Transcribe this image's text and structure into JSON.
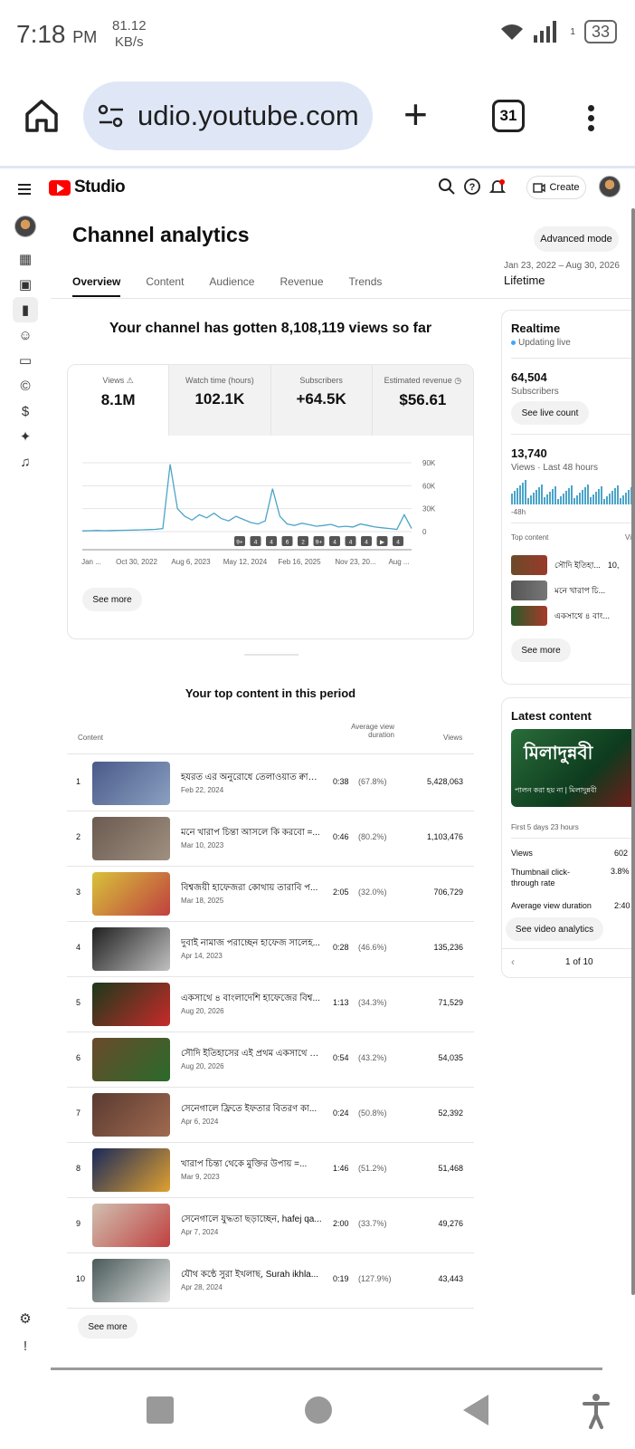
{
  "status": {
    "time": "7:18",
    "ampm": "PM",
    "speed_value": "81.12",
    "speed_unit": "KB/s",
    "battery": "33",
    "sim_slot": "1"
  },
  "browser": {
    "url": "udio.youtube.com",
    "tab_count": "31"
  },
  "studio": {
    "logo_text": "Studio",
    "create_label": "Create",
    "page_title": "Channel analytics",
    "advanced_mode": "Advanced mode",
    "date_range": "Jan 23, 2022 – Aug 30, 2026",
    "period": "Lifetime",
    "tabs": [
      {
        "label": "Overview"
      },
      {
        "label": "Content"
      },
      {
        "label": "Audience"
      },
      {
        "label": "Revenue"
      },
      {
        "label": "Trends"
      }
    ],
    "headline": "Your channel has gotten 8,108,119 views so far",
    "metrics": [
      {
        "label": "Views",
        "value": "8.1M"
      },
      {
        "label": "Watch time (hours)",
        "value": "102.1K"
      },
      {
        "label": "Subscribers",
        "value": "+64.5K"
      },
      {
        "label": "Estimated revenue",
        "value": "$56.61"
      }
    ],
    "see_more": "See more",
    "top_title": "Your top content in this period",
    "columns": {
      "content": "Content",
      "avg_line1": "Average view",
      "avg_line2": "duration",
      "views": "Views"
    },
    "rows": [
      {
        "rank": "1",
        "title": "হযরত এর অনুরোধে তেলাওয়াত ক্বারী...",
        "date": "Feb 22, 2024",
        "dur": "0:38",
        "pct": "(67.8%)",
        "views": "5,428,063"
      },
      {
        "rank": "2",
        "title": "মনে খারাপ চিন্তা আসলে কি করবো =...",
        "date": "Mar 10, 2023",
        "dur": "0:46",
        "pct": "(80.2%)",
        "views": "1,103,476"
      },
      {
        "rank": "3",
        "title": "বিশ্বজয়ী হাফেজরা কোথায় তারাবি প...",
        "date": "Mar 18, 2025",
        "dur": "2:05",
        "pct": "(32.0%)",
        "views": "706,729"
      },
      {
        "rank": "4",
        "title": "দুবাই নামাজ পরাচ্ছেন হাফেজ সালেহ...",
        "date": "Apr 14, 2023",
        "dur": "0:28",
        "pct": "(46.6%)",
        "views": "135,236"
      },
      {
        "rank": "5",
        "title": "একসাথে ৪ বাংলাদেশি হাফেজের বিশ্ব...",
        "date": "Aug 20, 2026",
        "dur": "1:13",
        "pct": "(34.3%)",
        "views": "71,529"
      },
      {
        "rank": "6",
        "title": "সৌদি ইতিহাসের এই প্রথম একসাথে ৪...",
        "date": "Aug 20, 2026",
        "dur": "0:54",
        "pct": "(43.2%)",
        "views": "54,035"
      },
      {
        "rank": "7",
        "title": "সেনেগালে ফ্রিতে ইফতার বিতরণ কা...",
        "date": "Apr 6, 2024",
        "dur": "0:24",
        "pct": "(50.8%)",
        "views": "52,392"
      },
      {
        "rank": "8",
        "title": "খারাপ চিন্তা থেকে মুক্তির উপায় =...",
        "date": "Mar 9, 2023",
        "dur": "1:46",
        "pct": "(51.2%)",
        "views": "51,468"
      },
      {
        "rank": "9",
        "title": "সেনেগালে যুদ্ধতা ছড়াচ্ছেন, hafej qa...",
        "date": "Apr 7, 2024",
        "dur": "2:00",
        "pct": "(33.7%)",
        "views": "49,276"
      },
      {
        "rank": "10",
        "title": "যৌথ কন্ঠে সুরা ইখলাছ, Surah ikhla...",
        "date": "Apr 28, 2024",
        "dur": "0:19",
        "pct": "(127.9%)",
        "views": "43,443"
      }
    ],
    "realtime": {
      "title": "Realtime",
      "status": "Updating live",
      "subs_value": "64,504",
      "subs_label": "Subscribers",
      "live_count_btn": "See live count",
      "views_value": "13,740",
      "views_label": "Views · Last 48 hours",
      "axis_label": "-48h",
      "top_content_label": "Top content",
      "top_content_col": "Vi",
      "items": [
        {
          "title": "সৌদি ইতিহা...",
          "views": "10,"
        },
        {
          "title": "মনে খারাপ চি...",
          "views": ""
        },
        {
          "title": "একসাথে ৪ বাং...",
          "views": ""
        }
      ],
      "see_more": "See more"
    },
    "latest": {
      "title": "Latest content",
      "thumb_text": "মিলাদুন্নবী",
      "thumb_sub": "পালন করা হয় না | মিলাদুন্নবী",
      "age": "First 5 days 23 hours",
      "views_label": "Views",
      "views_value": "602",
      "ctr_label": "Thumbnail click-through rate",
      "ctr_value": "3.8%",
      "avd_label": "Average view duration",
      "avd_value": "2:40",
      "analytics_btn": "See video analytics",
      "pager": "1 of 10"
    }
  },
  "chart_data": {
    "type": "line",
    "x": [
      "Jan ...",
      "Oct 30, 2022",
      "Aug 6, 2023",
      "May 12, 2024",
      "Feb 16, 2025",
      "Nov 23, 20...",
      "Aug ..."
    ],
    "y_ticks": [
      "90K",
      "60K",
      "30K",
      "0"
    ],
    "ylim": [
      0,
      90000
    ],
    "series": [
      {
        "values": [
          1000,
          1200,
          1500,
          1200,
          1400,
          1600,
          1800,
          2000,
          2200,
          2600,
          3000,
          4000,
          88000,
          30000,
          20000,
          15000,
          22000,
          18000,
          24000,
          17000,
          14000,
          20000,
          16000,
          12000,
          10000,
          14000,
          56000,
          20000,
          10000,
          8000,
          11000,
          9000,
          7000,
          8000,
          9500,
          6000,
          7000,
          6000,
          10000,
          8000,
          6000,
          5000,
          4000,
          3000,
          22000,
          4000
        ]
      }
    ],
    "markers": [
      "9+",
      "4",
      "4",
      "6",
      "2",
      "9+",
      "4",
      "4",
      "4",
      "▶",
      "4"
    ],
    "color": "#4ba4c9"
  }
}
